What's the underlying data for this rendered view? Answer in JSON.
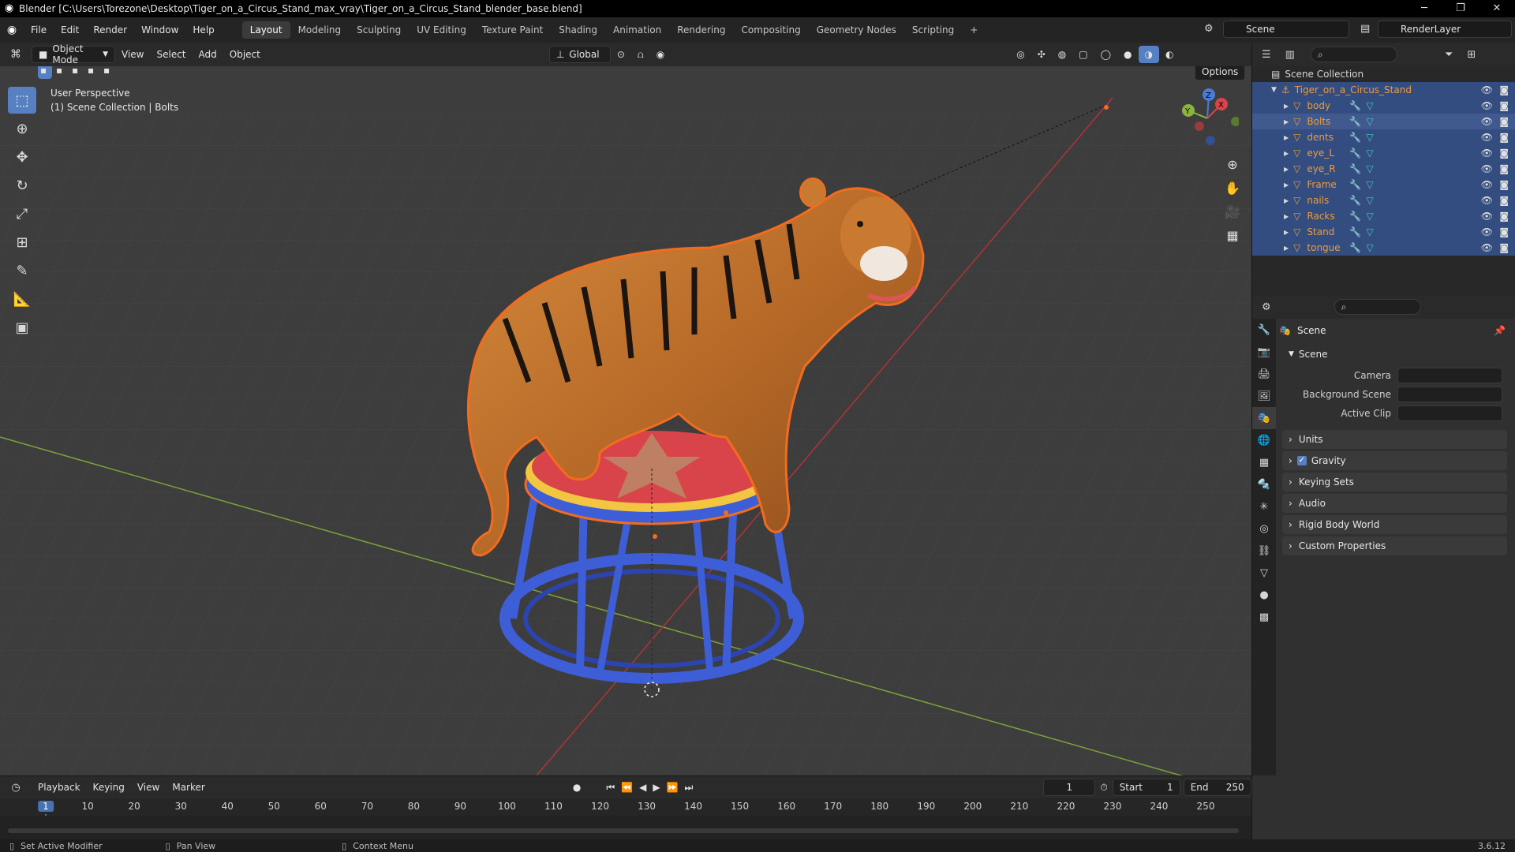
{
  "title_bar": {
    "title": "Blender [C:\\Users\\Torezone\\Desktop\\Tiger_on_a_Circus_Stand_max_vray\\Tiger_on_a_Circus_Stand_blender_base.blend]",
    "minimize": "─",
    "maximize": "❐",
    "close": "✕"
  },
  "menu": {
    "items": [
      "File",
      "Edit",
      "Render",
      "Window",
      "Help"
    ],
    "workspaces": [
      "Layout",
      "Modeling",
      "Sculpting",
      "UV Editing",
      "Texture Paint",
      "Shading",
      "Animation",
      "Rendering",
      "Compositing",
      "Geometry Nodes",
      "Scripting"
    ],
    "add_tab": "+",
    "scene": "Scene",
    "view_layer": "RenderLayer"
  },
  "viewport_header": {
    "mode": "Object Mode",
    "menus": [
      "View",
      "Select",
      "Add",
      "Object"
    ],
    "orientation": "Global",
    "options": "Options"
  },
  "viewport": {
    "perspective": "User Perspective",
    "collection_info": "(1) Scene Collection | Bolts",
    "gizmo_axes": {
      "x": "X",
      "y": "Y",
      "z": "Z"
    }
  },
  "outliner": {
    "root": "Scene Collection",
    "collection": "Tiger_on_a_Circus_Stand",
    "objects": [
      "body",
      "Bolts",
      "dents",
      "eye_L",
      "eye_R",
      "Frame",
      "nails",
      "Racks",
      "Stand",
      "tongue"
    ],
    "selected_object": "Bolts"
  },
  "properties": {
    "header": "Scene",
    "panel": "Scene",
    "fields": [
      {
        "label": "Camera"
      },
      {
        "label": "Background Scene"
      },
      {
        "label": "Active Clip"
      }
    ],
    "sections": [
      "Units",
      "Gravity",
      "Keying Sets",
      "Audio",
      "Rigid Body World",
      "Custom Properties"
    ],
    "gravity_checked": true
  },
  "timeline": {
    "menus": [
      "Playback",
      "Keying",
      "View",
      "Marker"
    ],
    "current_frame": "1",
    "start_label": "Start",
    "start_value": "1",
    "end_label": "End",
    "end_value": "250",
    "ruler": [
      "1",
      "10",
      "20",
      "30",
      "40",
      "50",
      "60",
      "70",
      "80",
      "90",
      "100",
      "110",
      "120",
      "130",
      "140",
      "150",
      "160",
      "170",
      "180",
      "190",
      "200",
      "210",
      "220",
      "230",
      "240",
      "250"
    ]
  },
  "status_bar": {
    "left_action": "Set Active Modifier",
    "middle_action": "Pan View",
    "right_action": "Context Menu",
    "version": "3.6.12"
  },
  "colors": {
    "accent": "#5680c2",
    "selected_row": "#334d80",
    "object_orange": "#ef9b3a",
    "outline_orange": "#f36c1e"
  }
}
